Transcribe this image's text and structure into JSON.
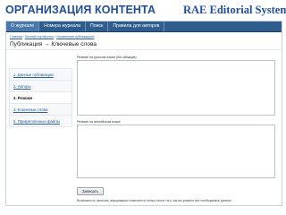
{
  "slide": {
    "title_left": "ОРГАНИЗАЦИЯ КОНТЕНТА",
    "title_right": "RAE Editorial System"
  },
  "topnav": {
    "items": [
      "О журнале",
      "Номера журнала",
      "Поиск",
      "Правила для авторов"
    ],
    "active_index": 0
  },
  "breadcrumb": {
    "items": [
      "Главная",
      "Личный портфолио",
      "Управление публикацией"
    ]
  },
  "page": {
    "heading": "Публикация → Ключевые слова"
  },
  "sidebar": {
    "items": [
      "1. Данные публикации",
      "2. Авторы",
      "3. Резюме",
      "4. Ключевые слова",
      "5. Прикрепленные файлы"
    ],
    "active_index": 2
  },
  "form": {
    "label_ru": "Резюме на русском языке (без абзацев)",
    "label_en": "Резюме на английском языке",
    "save_label": "Записать",
    "note": "Возможность записать информацию появляется только после того, как вы укажете все необходимые данные."
  }
}
